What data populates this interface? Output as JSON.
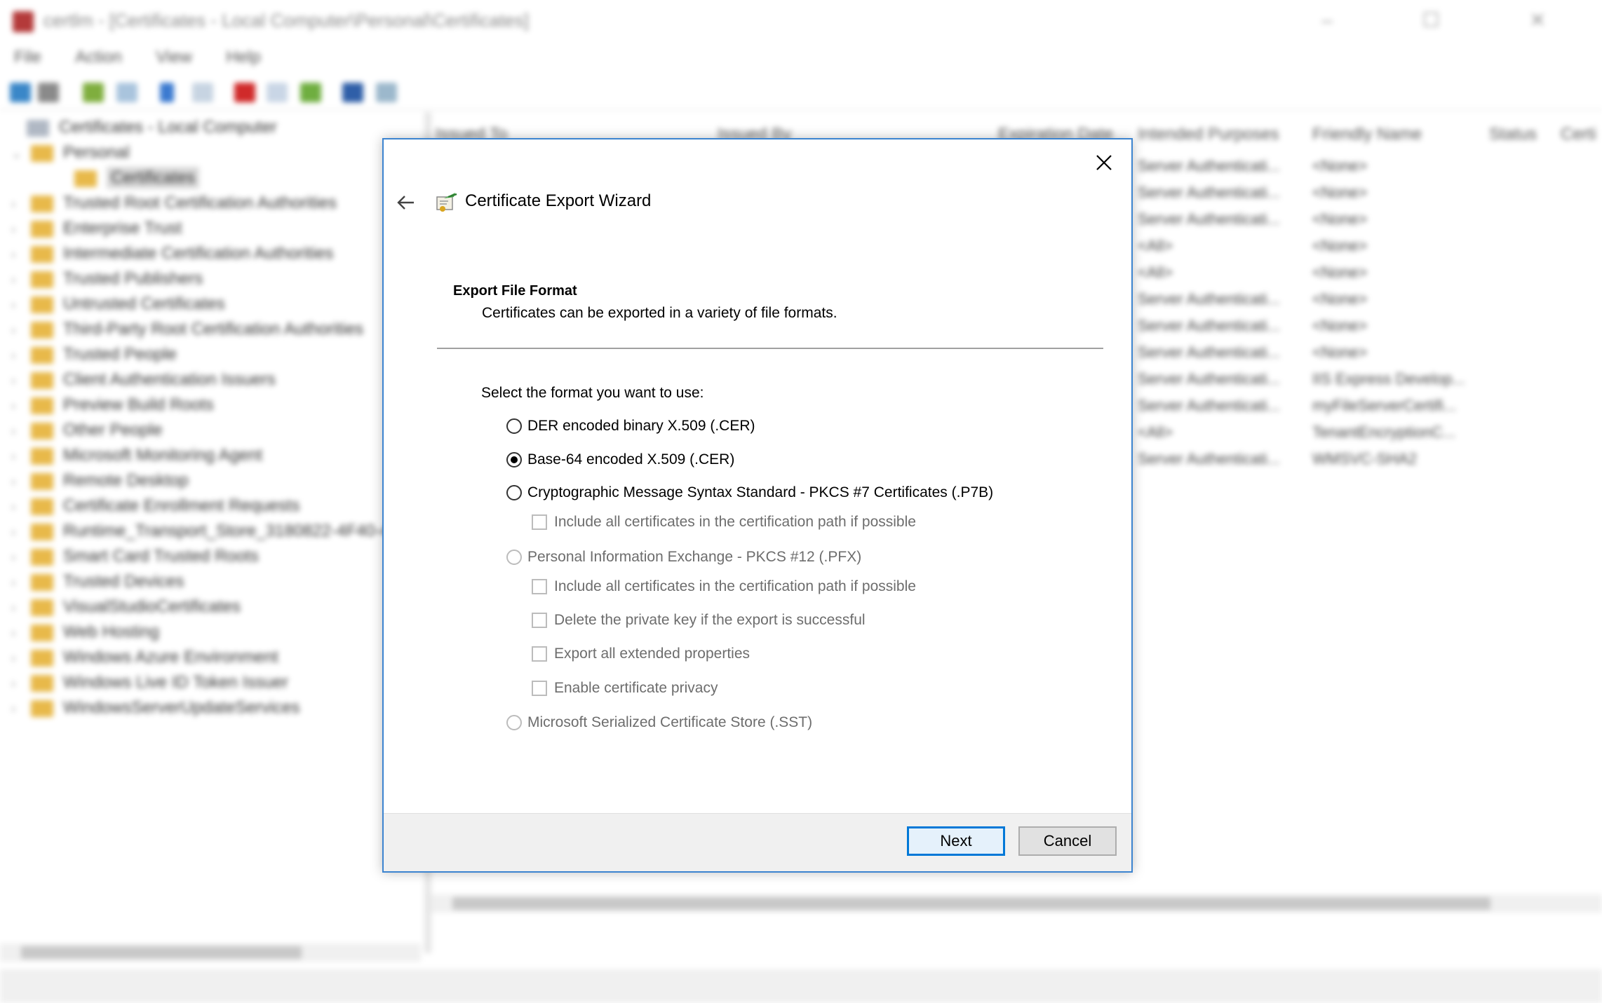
{
  "background_window": {
    "title": "certlm - [Certificates - Local Computer\\Personal\\Certificates]",
    "menu": [
      "File",
      "Action",
      "View",
      "Help"
    ],
    "tree": [
      {
        "label": "Certificates - Local Computer",
        "level": 0
      },
      {
        "label": "Personal",
        "level": 1
      },
      {
        "label": "Certificates",
        "level": 2
      },
      {
        "label": "Trusted Root Certification Authorities",
        "level": 1
      },
      {
        "label": "Enterprise Trust",
        "level": 1
      },
      {
        "label": "Intermediate Certification Authorities",
        "level": 1
      },
      {
        "label": "Trusted Publishers",
        "level": 1
      },
      {
        "label": "Untrusted Certificates",
        "level": 1
      },
      {
        "label": "Third-Party Root Certification Authorities",
        "level": 1
      },
      {
        "label": "Trusted People",
        "level": 1
      },
      {
        "label": "Client Authentication Issuers",
        "level": 1
      },
      {
        "label": "Preview Build Roots",
        "level": 1
      },
      {
        "label": "Other People",
        "level": 1
      },
      {
        "label": "Microsoft Monitoring Agent",
        "level": 1
      },
      {
        "label": "Remote Desktop",
        "level": 1
      },
      {
        "label": "Certificate Enrollment Requests",
        "level": 1
      },
      {
        "label": "Runtime_Transport_Store_3180822-4F40-4",
        "level": 1
      },
      {
        "label": "Smart Card Trusted Roots",
        "level": 1
      },
      {
        "label": "Trusted Devices",
        "level": 1
      },
      {
        "label": "VisualStudioCertificates",
        "level": 1
      },
      {
        "label": "Web Hosting",
        "level": 1
      },
      {
        "label": "Windows Azure Environment",
        "level": 1
      },
      {
        "label": "Windows Live ID Token Issuer",
        "level": 1
      },
      {
        "label": "WindowsServerUpdateServices",
        "level": 1
      }
    ],
    "columns": [
      "Issued To",
      "Issued By",
      "Expiration Date",
      "Intended Purposes",
      "Friendly Name",
      "Status",
      "Certi"
    ],
    "rows": [
      {
        "purpose": "Server Authenticati...",
        "friendly": "<None>"
      },
      {
        "purpose": "Server Authenticati...",
        "friendly": "<None>"
      },
      {
        "purpose": "Server Authenticati...",
        "friendly": "<None>"
      },
      {
        "purpose": "<All>",
        "friendly": "<None>"
      },
      {
        "purpose": "<All>",
        "friendly": "<None>"
      },
      {
        "purpose": "Server Authenticati...",
        "friendly": "<None>"
      },
      {
        "purpose": "Server Authenticati...",
        "friendly": "<None>"
      },
      {
        "purpose": "Server Authenticati...",
        "friendly": "<None>"
      },
      {
        "purpose": "Server Authenticati...",
        "friendly": "IIS Express Develop..."
      },
      {
        "purpose": "Server Authenticati...",
        "friendly": "myFileServerCertifi..."
      },
      {
        "purpose": "<All>",
        "friendly": "TenantEncryptionC..."
      },
      {
        "purpose": "Server Authenticati...",
        "friendly": "WMSVC-SHA2"
      }
    ]
  },
  "dialog": {
    "title": "Certificate Export Wizard",
    "section_title": "Export File Format",
    "section_subtitle": "Certificates can be exported in a variety of file formats.",
    "prompt": "Select the format you want to use:",
    "options": {
      "der": {
        "label": "DER encoded binary X.509 (.CER)",
        "checked": false,
        "enabled": true
      },
      "base64": {
        "label": "Base-64 encoded X.509 (.CER)",
        "checked": true,
        "enabled": true
      },
      "pkcs7": {
        "label": "Cryptographic Message Syntax Standard - PKCS #7 Certificates (.P7B)",
        "checked": false,
        "enabled": true
      },
      "pkcs7_include_all": {
        "label": "Include all certificates in the certification path if possible",
        "checked": false,
        "enabled": false
      },
      "pfx": {
        "label": "Personal Information Exchange - PKCS #12 (.PFX)",
        "checked": false,
        "enabled": false
      },
      "pfx_include_all": {
        "label": "Include all certificates in the certification path if possible",
        "checked": false,
        "enabled": false
      },
      "pfx_delete_key": {
        "label": "Delete the private key if the export is successful",
        "checked": false,
        "enabled": false
      },
      "pfx_export_ext": {
        "label": "Export all extended properties",
        "checked": false,
        "enabled": false
      },
      "pfx_privacy": {
        "label": "Enable certificate privacy",
        "checked": false,
        "enabled": false
      },
      "sst": {
        "label": "Microsoft Serialized Certificate Store (.SST)",
        "checked": false,
        "enabled": false
      }
    },
    "buttons": {
      "next": "Next",
      "cancel": "Cancel"
    }
  },
  "colors": {
    "accent": "#0078d7",
    "dialog_border": "#3c84d0",
    "folder": "#e8b94a",
    "disabled_text": "#6d6d6d"
  }
}
